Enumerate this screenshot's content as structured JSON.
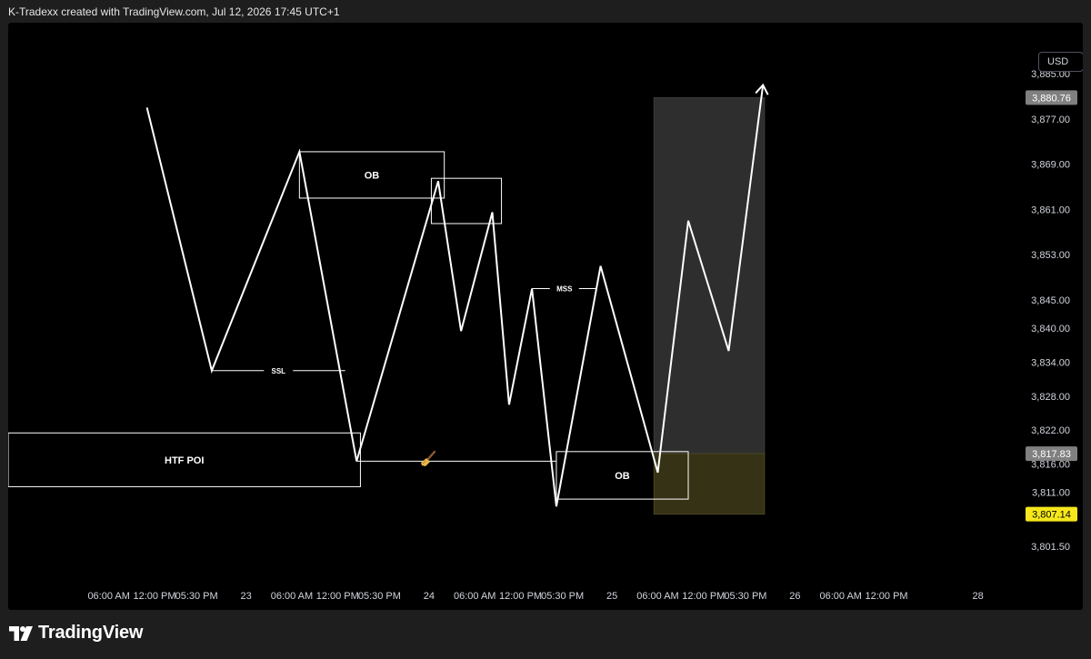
{
  "header": {
    "caption": "K-Tradexx created with TradingView.com, Jul 12, 2026 17:45 UTC+1"
  },
  "toolbar": {
    "currency_label": "USD"
  },
  "branding": {
    "logo_text": "TradingView"
  },
  "colors": {
    "background": "#000000",
    "price_line": "#ffffff",
    "zone_gray": "#2e2e2e",
    "zone_yellow": "#353215",
    "label_current": "#808080",
    "label_highlight": "#f5e71c"
  },
  "chart_data": {
    "type": "line",
    "title": "",
    "price_axis": {
      "range": [
        3796.0,
        3894.0
      ],
      "ticks": [
        3885.0,
        3877.0,
        3869.0,
        3861.0,
        3853.0,
        3845.0,
        3840.0,
        3834.0,
        3828.0,
        3822.0,
        3816.0,
        3811.0,
        3801.5
      ],
      "tick_labels": [
        "3,885.00",
        "3,877.00",
        "3,869.00",
        "3,861.00",
        "3,853.00",
        "3,845.00",
        "3,840.00",
        "3,834.00",
        "3,828.00",
        "3,822.00",
        "3,816.00",
        "3,811.00",
        "3,801.50"
      ],
      "price_labels": [
        {
          "value": 3880.76,
          "text": "3,880.76",
          "style": "gray"
        },
        {
          "value": 3817.83,
          "text": "3,817.83",
          "style": "gray"
        },
        {
          "value": 3807.14,
          "text": "3,807.14",
          "style": "yellow"
        }
      ]
    },
    "time_axis": {
      "range": [
        -7.2,
        126.0
      ],
      "ticks": [
        {
          "h": 6,
          "label": "06:00 AM"
        },
        {
          "h": 12,
          "label": "12:00 PM"
        },
        {
          "h": 17.5,
          "label": "05:30 PM"
        },
        {
          "h": 24,
          "label": "23"
        },
        {
          "h": 30,
          "label": "06:00 AM"
        },
        {
          "h": 36,
          "label": "12:00 PM"
        },
        {
          "h": 41.5,
          "label": "05:30 PM"
        },
        {
          "h": 48,
          "label": "24"
        },
        {
          "h": 54,
          "label": "06:00 AM"
        },
        {
          "h": 60,
          "label": "12:00 PM"
        },
        {
          "h": 65.5,
          "label": "05:30 PM"
        },
        {
          "h": 72,
          "label": "25"
        },
        {
          "h": 78,
          "label": "06:00 AM"
        },
        {
          "h": 84,
          "label": "12:00 PM"
        },
        {
          "h": 89.5,
          "label": "05:30 PM"
        },
        {
          "h": 96,
          "label": "26"
        },
        {
          "h": 102,
          "label": "06:00 AM"
        },
        {
          "h": 108,
          "label": "12:00 PM"
        },
        {
          "h": 120,
          "label": "28"
        }
      ]
    },
    "price_path": [
      {
        "h": 11.0,
        "p": 3879.0
      },
      {
        "h": 19.5,
        "p": 3832.5
      },
      {
        "h": 31.0,
        "p": 3871.2
      },
      {
        "h": 38.5,
        "p": 3816.5
      },
      {
        "h": 49.2,
        "p": 3866.0
      },
      {
        "h": 52.2,
        "p": 3839.5
      },
      {
        "h": 56.3,
        "p": 3860.5
      },
      {
        "h": 58.5,
        "p": 3826.5
      },
      {
        "h": 61.5,
        "p": 3847.0
      },
      {
        "h": 64.7,
        "p": 3808.5
      },
      {
        "h": 70.5,
        "p": 3851.0
      },
      {
        "h": 78.0,
        "p": 3814.5
      },
      {
        "h": 82.0,
        "p": 3859.0
      },
      {
        "h": 87.3,
        "p": 3836.0
      },
      {
        "h": 91.8,
        "p": 3883.0
      }
    ],
    "levels": [
      {
        "label": "SSL",
        "h1": 19.5,
        "h2": 37.0,
        "p": 3832.5
      },
      {
        "label": "MSS",
        "h1": 61.5,
        "h2": 70.0,
        "p": 3847.0
      },
      {
        "label": "",
        "h1": 38.5,
        "h2": 64.7,
        "p": 3816.5
      }
    ],
    "boxes": [
      {
        "label": "HTF POI",
        "h1": -7.2,
        "h2": 39.0,
        "p_top": 3821.5,
        "p_bot": 3812.0
      },
      {
        "label": "OB",
        "h1": 31.0,
        "h2": 50.0,
        "p_top": 3871.2,
        "p_bot": 3863.0
      },
      {
        "label": "",
        "h1": 48.3,
        "h2": 57.5,
        "p_top": 3866.5,
        "p_bot": 3858.5
      },
      {
        "label": "OB",
        "h1": 64.7,
        "h2": 82.0,
        "p_top": 3818.2,
        "p_bot": 3809.8
      }
    ],
    "zones": [
      {
        "h1": 77.5,
        "h2": 92.0,
        "p_top": 3880.76,
        "p_bot": 3817.83,
        "color": "gray"
      },
      {
        "h1": 77.5,
        "h2": 92.0,
        "p_top": 3817.83,
        "p_bot": 3807.14,
        "color": "yellow"
      }
    ],
    "grid": false,
    "legend": "none"
  }
}
